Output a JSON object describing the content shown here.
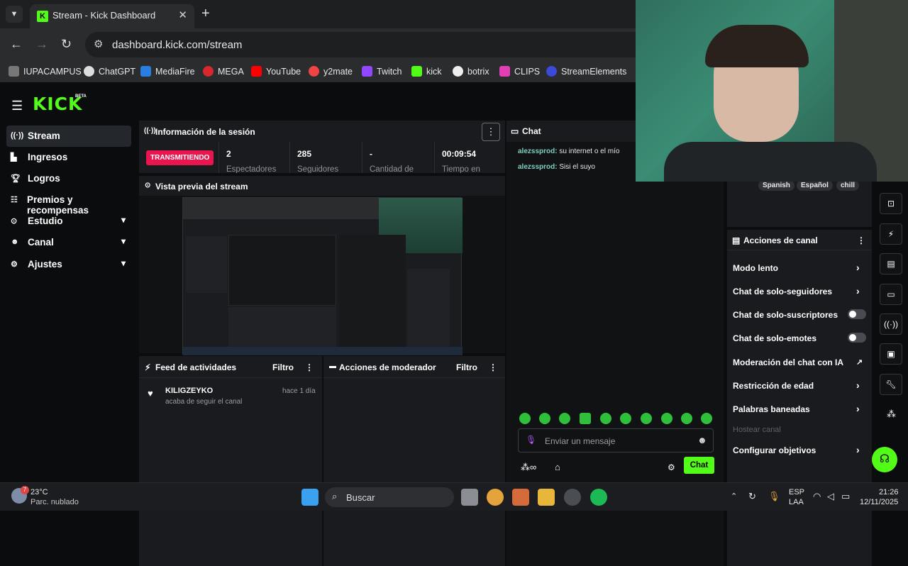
{
  "browser": {
    "tab_title": "Stream - Kick Dashboard",
    "url": "dashboard.kick.com/stream",
    "bookmarks": [
      "IUPACAMPUS",
      "ChatGPT",
      "MediaFire",
      "MEGA",
      "YouTube",
      "y2mate",
      "Twitch",
      "kick",
      "botrix",
      "CLIPS",
      "StreamElements"
    ]
  },
  "app": {
    "logo": "KICK",
    "beta": "BETA"
  },
  "sidebar": {
    "items": [
      {
        "label": "Stream",
        "icon": "broadcast-icon"
      },
      {
        "label": "Ingresos",
        "icon": "chart-icon"
      },
      {
        "label": "Logros",
        "icon": "trophy-icon"
      },
      {
        "label": "Premios y recompensas",
        "icon": "list-icon"
      },
      {
        "label": "Estudio",
        "icon": "studio-icon"
      },
      {
        "label": "Canal",
        "icon": "person-icon"
      },
      {
        "label": "Ajustes",
        "icon": "gear-icon"
      }
    ]
  },
  "session": {
    "title": "Información de la sesión",
    "live_badge": "TRANSMITIENDO",
    "stats": [
      {
        "value": "2",
        "label": "Espectadores"
      },
      {
        "value": "285",
        "label": "Seguidores"
      },
      {
        "value": "-",
        "label": "Cantidad de"
      },
      {
        "value": "00:09:54",
        "label": "Tiempo en"
      }
    ]
  },
  "preview": {
    "title": "Vista previa del stream"
  },
  "feed": {
    "title": "Feed de actividades",
    "filter": "Filtro",
    "items": [
      {
        "user": "KILIGZEYKO",
        "action": "acaba de seguir el canal",
        "time": "hace 1 día"
      }
    ]
  },
  "mod_actions": {
    "title": "Acciones de moderador",
    "filter": "Filtro"
  },
  "chat": {
    "title": "Chat",
    "messages": [
      {
        "user": "alezssprod:",
        "text": "su internet o el mío"
      },
      {
        "user": "alezssprod:",
        "text": "Sisi el suyo"
      }
    ],
    "placeholder": "Enviar un mensaje",
    "send": "Chat"
  },
  "tags": [
    "Spanish",
    "Español",
    "chill"
  ],
  "channel_actions": {
    "title": "Acciones de canal",
    "items": [
      {
        "label": "Modo lento",
        "kind": "chevron"
      },
      {
        "label": "Chat de solo-seguidores",
        "kind": "chevron"
      },
      {
        "label": "Chat de solo-suscriptores",
        "kind": "toggle"
      },
      {
        "label": "Chat de solo-emotes",
        "kind": "toggle"
      },
      {
        "label": "Moderación del chat con IA",
        "kind": "external"
      },
      {
        "label": "Restricción de edad",
        "kind": "chevron"
      },
      {
        "label": "Palabras baneadas",
        "kind": "chevron"
      },
      {
        "label": "Hostear canal",
        "kind": "disabled"
      },
      {
        "label": "Configurar objetivos",
        "kind": "chevron"
      }
    ]
  },
  "taskbar": {
    "temp": "23°C",
    "weather": "Parc. nublado",
    "weather_badge": "7",
    "search": "Buscar",
    "lang1": "ESP",
    "lang2": "LAA",
    "time": "21:26",
    "date": "12/11/2025"
  },
  "colors": {
    "kick_green": "#53fc18",
    "live_red": "#e9154f",
    "panel": "#191b1f"
  }
}
